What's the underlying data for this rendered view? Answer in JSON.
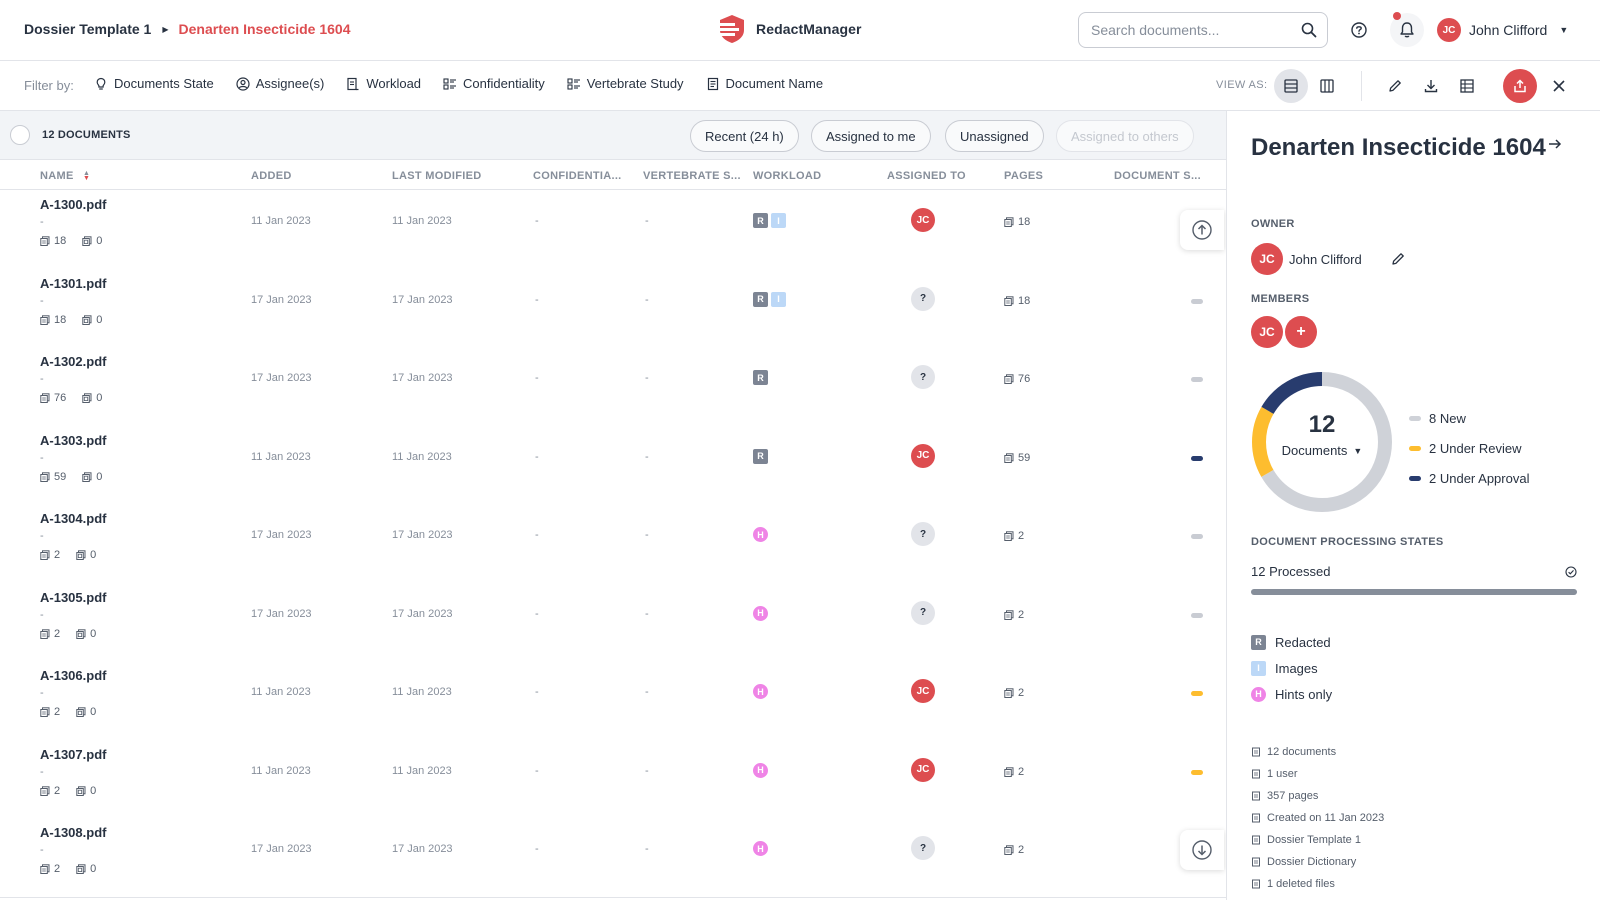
{
  "breadcrumb": {
    "parent": "Dossier Template 1",
    "current": "Denarten Insecticide 1604"
  },
  "brand": {
    "name": "RedactManager"
  },
  "search": {
    "placeholder": "Search documents..."
  },
  "user": {
    "initials": "JC",
    "name": "John Clifford"
  },
  "filterbar": {
    "label": "Filter by:",
    "filters": [
      "Documents State",
      "Assignee(s)",
      "Workload",
      "Confidentiality",
      "Vertebrate Study",
      "Document Name"
    ],
    "view_as_label": "VIEW AS:"
  },
  "listheader": {
    "count_label": "12 DOCUMENTS",
    "chips": [
      "Recent (24 h)",
      "Assigned to me",
      "Unassigned",
      "Assigned to others"
    ]
  },
  "columns": {
    "name": "NAME",
    "added": "ADDED",
    "last_modified": "LAST MODIFIED",
    "confidentiality": "CONFIDENTIA...",
    "vertebrate": "VERTEBRATE S...",
    "workload": "WORKLOAD",
    "assigned_to": "ASSIGNED TO",
    "pages": "PAGES",
    "document_state": "DOCUMENT S..."
  },
  "documents": [
    {
      "name": "A-1300.pdf",
      "dash": "-",
      "pages": "18",
      "annotations": "0",
      "added": "11 Jan 2023",
      "modified": "11 Jan 2023",
      "confidentiality": "-",
      "vertebrate": "-",
      "workload": [
        "R",
        "I"
      ],
      "assignee": "JC",
      "state_color": ""
    },
    {
      "name": "A-1301.pdf",
      "dash": "-",
      "pages": "18",
      "annotations": "0",
      "added": "17 Jan 2023",
      "modified": "17 Jan 2023",
      "confidentiality": "-",
      "vertebrate": "-",
      "workload": [
        "R",
        "I"
      ],
      "assignee": "?",
      "state_color": "#c9ccd3"
    },
    {
      "name": "A-1302.pdf",
      "dash": "-",
      "pages": "76",
      "annotations": "0",
      "added": "17 Jan 2023",
      "modified": "17 Jan 2023",
      "confidentiality": "-",
      "vertebrate": "-",
      "workload": [
        "R"
      ],
      "assignee": "?",
      "state_color": "#c9ccd3"
    },
    {
      "name": "A-1303.pdf",
      "dash": "-",
      "pages": "59",
      "annotations": "0",
      "added": "11 Jan 2023",
      "modified": "11 Jan 2023",
      "confidentiality": "-",
      "vertebrate": "-",
      "workload": [
        "R"
      ],
      "assignee": "JC",
      "state_color": "#283c6e"
    },
    {
      "name": "A-1304.pdf",
      "dash": "-",
      "pages": "2",
      "annotations": "0",
      "added": "17 Jan 2023",
      "modified": "17 Jan 2023",
      "confidentiality": "-",
      "vertebrate": "-",
      "workload": [
        "H"
      ],
      "assignee": "?",
      "state_color": "#c9ccd3"
    },
    {
      "name": "A-1305.pdf",
      "dash": "-",
      "pages": "2",
      "annotations": "0",
      "added": "17 Jan 2023",
      "modified": "17 Jan 2023",
      "confidentiality": "-",
      "vertebrate": "-",
      "workload": [
        "H"
      ],
      "assignee": "?",
      "state_color": "#c9ccd3"
    },
    {
      "name": "A-1306.pdf",
      "dash": "-",
      "pages": "2",
      "annotations": "0",
      "added": "11 Jan 2023",
      "modified": "11 Jan 2023",
      "confidentiality": "-",
      "vertebrate": "-",
      "workload": [
        "H"
      ],
      "assignee": "JC",
      "state_color": "#fdbd2f"
    },
    {
      "name": "A-1307.pdf",
      "dash": "-",
      "pages": "2",
      "annotations": "0",
      "added": "11 Jan 2023",
      "modified": "11 Jan 2023",
      "confidentiality": "-",
      "vertebrate": "-",
      "workload": [
        "H"
      ],
      "assignee": "JC",
      "state_color": "#fdbd2f"
    },
    {
      "name": "A-1308.pdf",
      "dash": "-",
      "pages": "2",
      "annotations": "0",
      "added": "17 Jan 2023",
      "modified": "17 Jan 2023",
      "confidentiality": "-",
      "vertebrate": "-",
      "workload": [
        "H"
      ],
      "assignee": "?",
      "state_color": ""
    }
  ],
  "panel": {
    "title": "Denarten Insecticide 1604",
    "owner_label": "OWNER",
    "owner": {
      "initials": "JC",
      "name": "John Clifford"
    },
    "members_label": "MEMBERS",
    "members": [
      "JC"
    ],
    "add_member": "+",
    "donut": {
      "total": "12",
      "selector": "Documents",
      "segments": [
        {
          "label": "8 New",
          "count": 8,
          "color": "#cfd2d8"
        },
        {
          "label": "2 Under Review",
          "count": 2,
          "color": "#fdbd2f"
        },
        {
          "label": "2 Under Approval",
          "count": 2,
          "color": "#283c6e"
        }
      ]
    },
    "processing_label": "DOCUMENT PROCESSING STATES",
    "processed_text": "12 Processed",
    "processed_fraction": 1.0,
    "workload_legend": [
      {
        "badge": "R",
        "label": "Redacted"
      },
      {
        "badge": "I",
        "label": "Images"
      },
      {
        "badge": "H",
        "label": "Hints only"
      }
    ],
    "stats": [
      {
        "icon": "document-icon",
        "text": "12 documents"
      },
      {
        "icon": "user-icon",
        "text": "1 user"
      },
      {
        "icon": "pages-icon",
        "text": "357 pages"
      },
      {
        "icon": "calendar-icon",
        "text": "Created on 11 Jan 2023"
      },
      {
        "icon": "template-icon",
        "text": "Dossier Template 1"
      },
      {
        "icon": "dictionary-icon",
        "text": "Dossier Dictionary"
      },
      {
        "icon": "trash-icon",
        "text": "1 deleted files"
      }
    ]
  },
  "colors": {
    "accent": "#dd4d50",
    "text": "#283241",
    "muted": "#868e9a"
  }
}
